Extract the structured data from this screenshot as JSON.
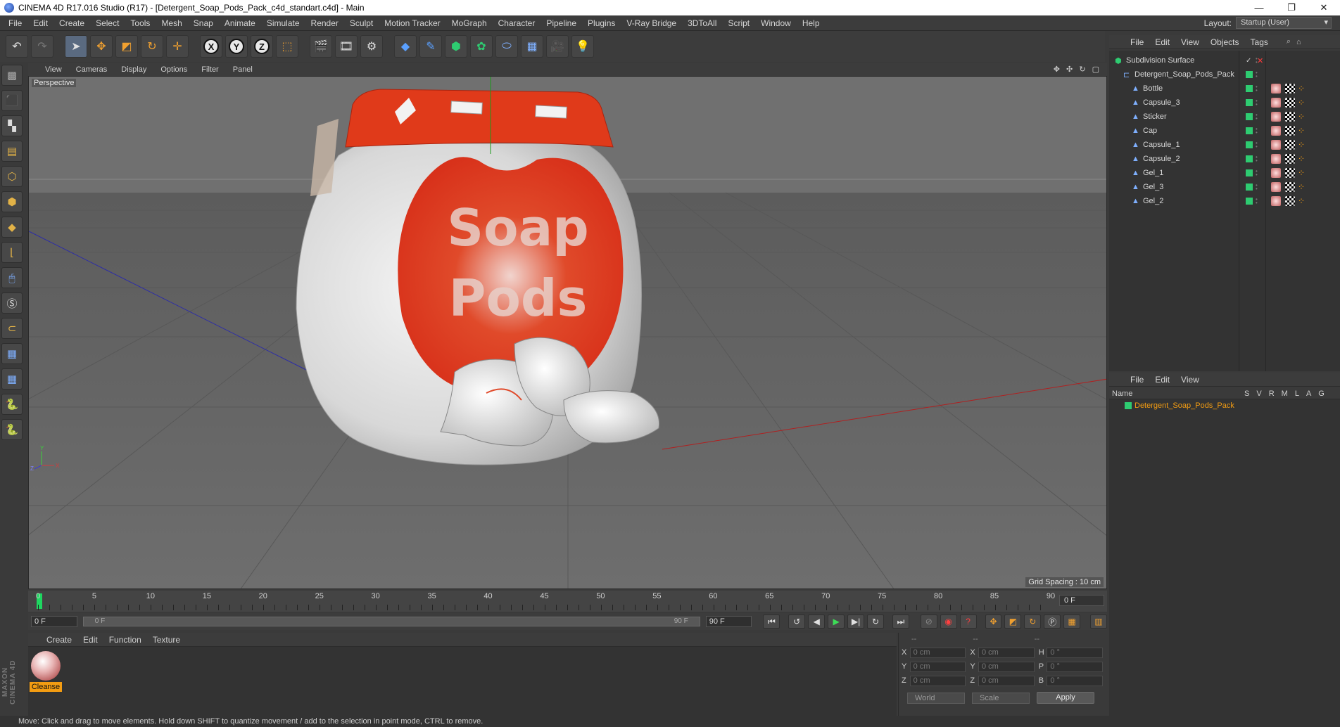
{
  "window": {
    "title": "CINEMA 4D R17.016 Studio (R17) - [Detergent_Soap_Pods_Pack_c4d_standart.c4d] - Main",
    "controls": [
      "—",
      "❐",
      "✕"
    ]
  },
  "menu": [
    "File",
    "Edit",
    "Create",
    "Select",
    "Tools",
    "Mesh",
    "Snap",
    "Animate",
    "Simulate",
    "Render",
    "Sculpt",
    "Motion Tracker",
    "MoGraph",
    "Character",
    "Pipeline",
    "Plugins",
    "V-Ray Bridge",
    "3DToAll",
    "Script",
    "Window",
    "Help"
  ],
  "layout": {
    "label": "Layout:",
    "value": "Startup (User)"
  },
  "toolbar": {
    "undo_icon": "undo-icon",
    "axes": [
      "X",
      "Y",
      "Z"
    ]
  },
  "viewport": {
    "menus": [
      "View",
      "Cameras",
      "Display",
      "Options",
      "Filter",
      "Panel"
    ],
    "camera_label": "Perspective",
    "grid_spacing": "Grid Spacing : 10 cm",
    "label_line1": "Soap",
    "label_line2": "Pods",
    "nav_icons": "✥ ✣ ↻ ▢"
  },
  "timeline": {
    "ticks": [
      "0",
      "5",
      "10",
      "15",
      "20",
      "25",
      "30",
      "35",
      "40",
      "45",
      "50",
      "55",
      "60",
      "65",
      "70",
      "75",
      "80",
      "85",
      "90"
    ],
    "current_frame": "0 F"
  },
  "transport": {
    "start": "0 F",
    "range_start": "0 F",
    "range_end": "90 F",
    "end": "90 F"
  },
  "materials": {
    "menus": [
      "Create",
      "Edit",
      "Function",
      "Texture"
    ],
    "items": [
      {
        "name": "Cleanse"
      }
    ]
  },
  "coordinates": {
    "headers": [
      "--",
      "--",
      "--"
    ],
    "rows": [
      {
        "a1": "X",
        "v1": "0 cm",
        "a2": "X",
        "v2": "0 cm",
        "a3": "H",
        "v3": "0 °"
      },
      {
        "a1": "Y",
        "v1": "0 cm",
        "a2": "Y",
        "v2": "0 cm",
        "a3": "P",
        "v3": "0 °"
      },
      {
        "a1": "Z",
        "v1": "0 cm",
        "a2": "Z",
        "v2": "0 cm",
        "a3": "B",
        "v3": "0 °"
      }
    ],
    "mode1": "World",
    "mode2": "Scale",
    "apply": "Apply"
  },
  "object_manager": {
    "menus": [
      "File",
      "Edit",
      "View",
      "Objects",
      "Tags"
    ],
    "objects": [
      {
        "name": "Subdivision Surface",
        "depth": 0
      },
      {
        "name": "Detergent_Soap_Pods_Pack",
        "depth": 1
      },
      {
        "name": "Bottle",
        "depth": 2
      },
      {
        "name": "Capsule_3",
        "depth": 2
      },
      {
        "name": "Sticker",
        "depth": 2
      },
      {
        "name": "Cap",
        "depth": 2
      },
      {
        "name": "Capsule_1",
        "depth": 2
      },
      {
        "name": "Capsule_2",
        "depth": 2
      },
      {
        "name": "Gel_1",
        "depth": 2
      },
      {
        "name": "Gel_3",
        "depth": 2
      },
      {
        "name": "Gel_2",
        "depth": 2
      }
    ]
  },
  "layer_manager": {
    "menus": [
      "File",
      "Edit",
      "View"
    ],
    "columns": {
      "name": "Name",
      "flags": [
        "S",
        "V",
        "R",
        "M",
        "L",
        "A",
        "G"
      ]
    },
    "layer": "Detergent_Soap_Pods_Pack"
  },
  "status": "Move: Click and drag to move elements. Hold down SHIFT to quantize movement / add to the selection in point mode, CTRL to remove.",
  "brand": "MAXON CINEMA 4D"
}
